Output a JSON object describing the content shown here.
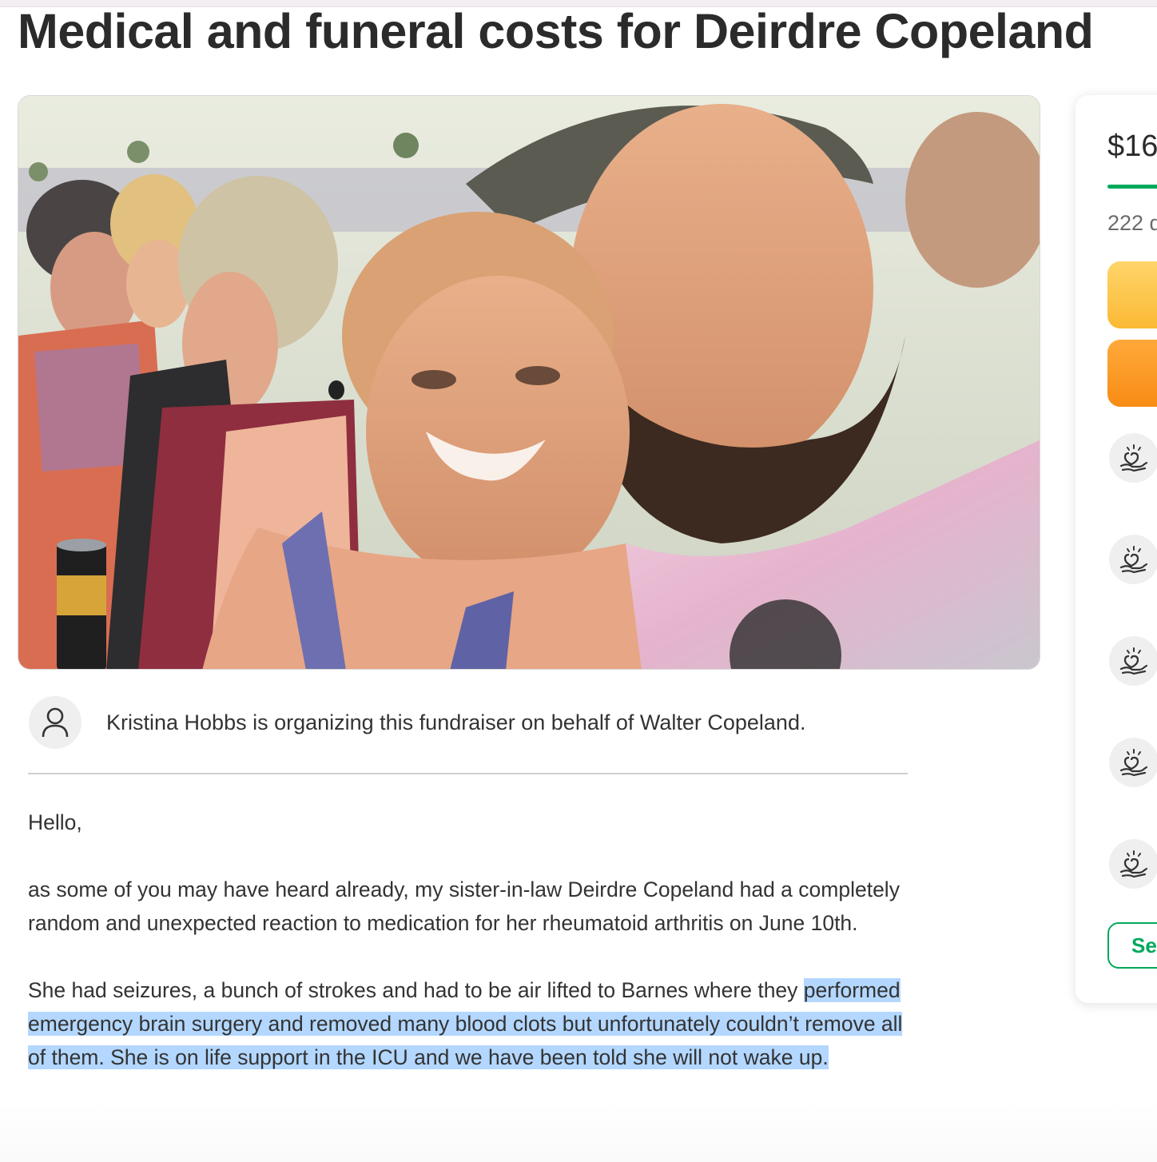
{
  "page": {
    "title": "Medical and funeral costs for Deirdre Copeland"
  },
  "organizer": {
    "text": "Kristina Hobbs is organizing this fundraiser on behalf of Walter Copeland.",
    "avatar_icon": "person-icon"
  },
  "story": {
    "greeting": "Hello,",
    "paragraph1": "as some of you may have heard already, my sister-in-law Deirdre Copeland had a completely random and unexpected reaction to medication for her rheumatoid arthritis on June 10th.",
    "paragraph2_line1": "She had seizures, a bunch of strokes and had to be air lifted to Barnes where they",
    "paragraph2_highlighted": "performed emergency brain surgery and removed many blood clots but unfortunately couldn’t remove all of them. She is on life support in the ICU and we have been told she will not wake up."
  },
  "sidebar": {
    "amount_raised": "$16",
    "donations_count": "222 d",
    "progress_fraction": 1.0,
    "see_button_label": "Se",
    "donor_icon": "heart-hand-icon",
    "donors": [
      {},
      {},
      {},
      {},
      {}
    ]
  },
  "colors": {
    "accent_green": "#02a95c",
    "share_yellow": "#fbb935",
    "donate_orange": "#f78c15",
    "selection_blue": "#b3d7ff"
  }
}
